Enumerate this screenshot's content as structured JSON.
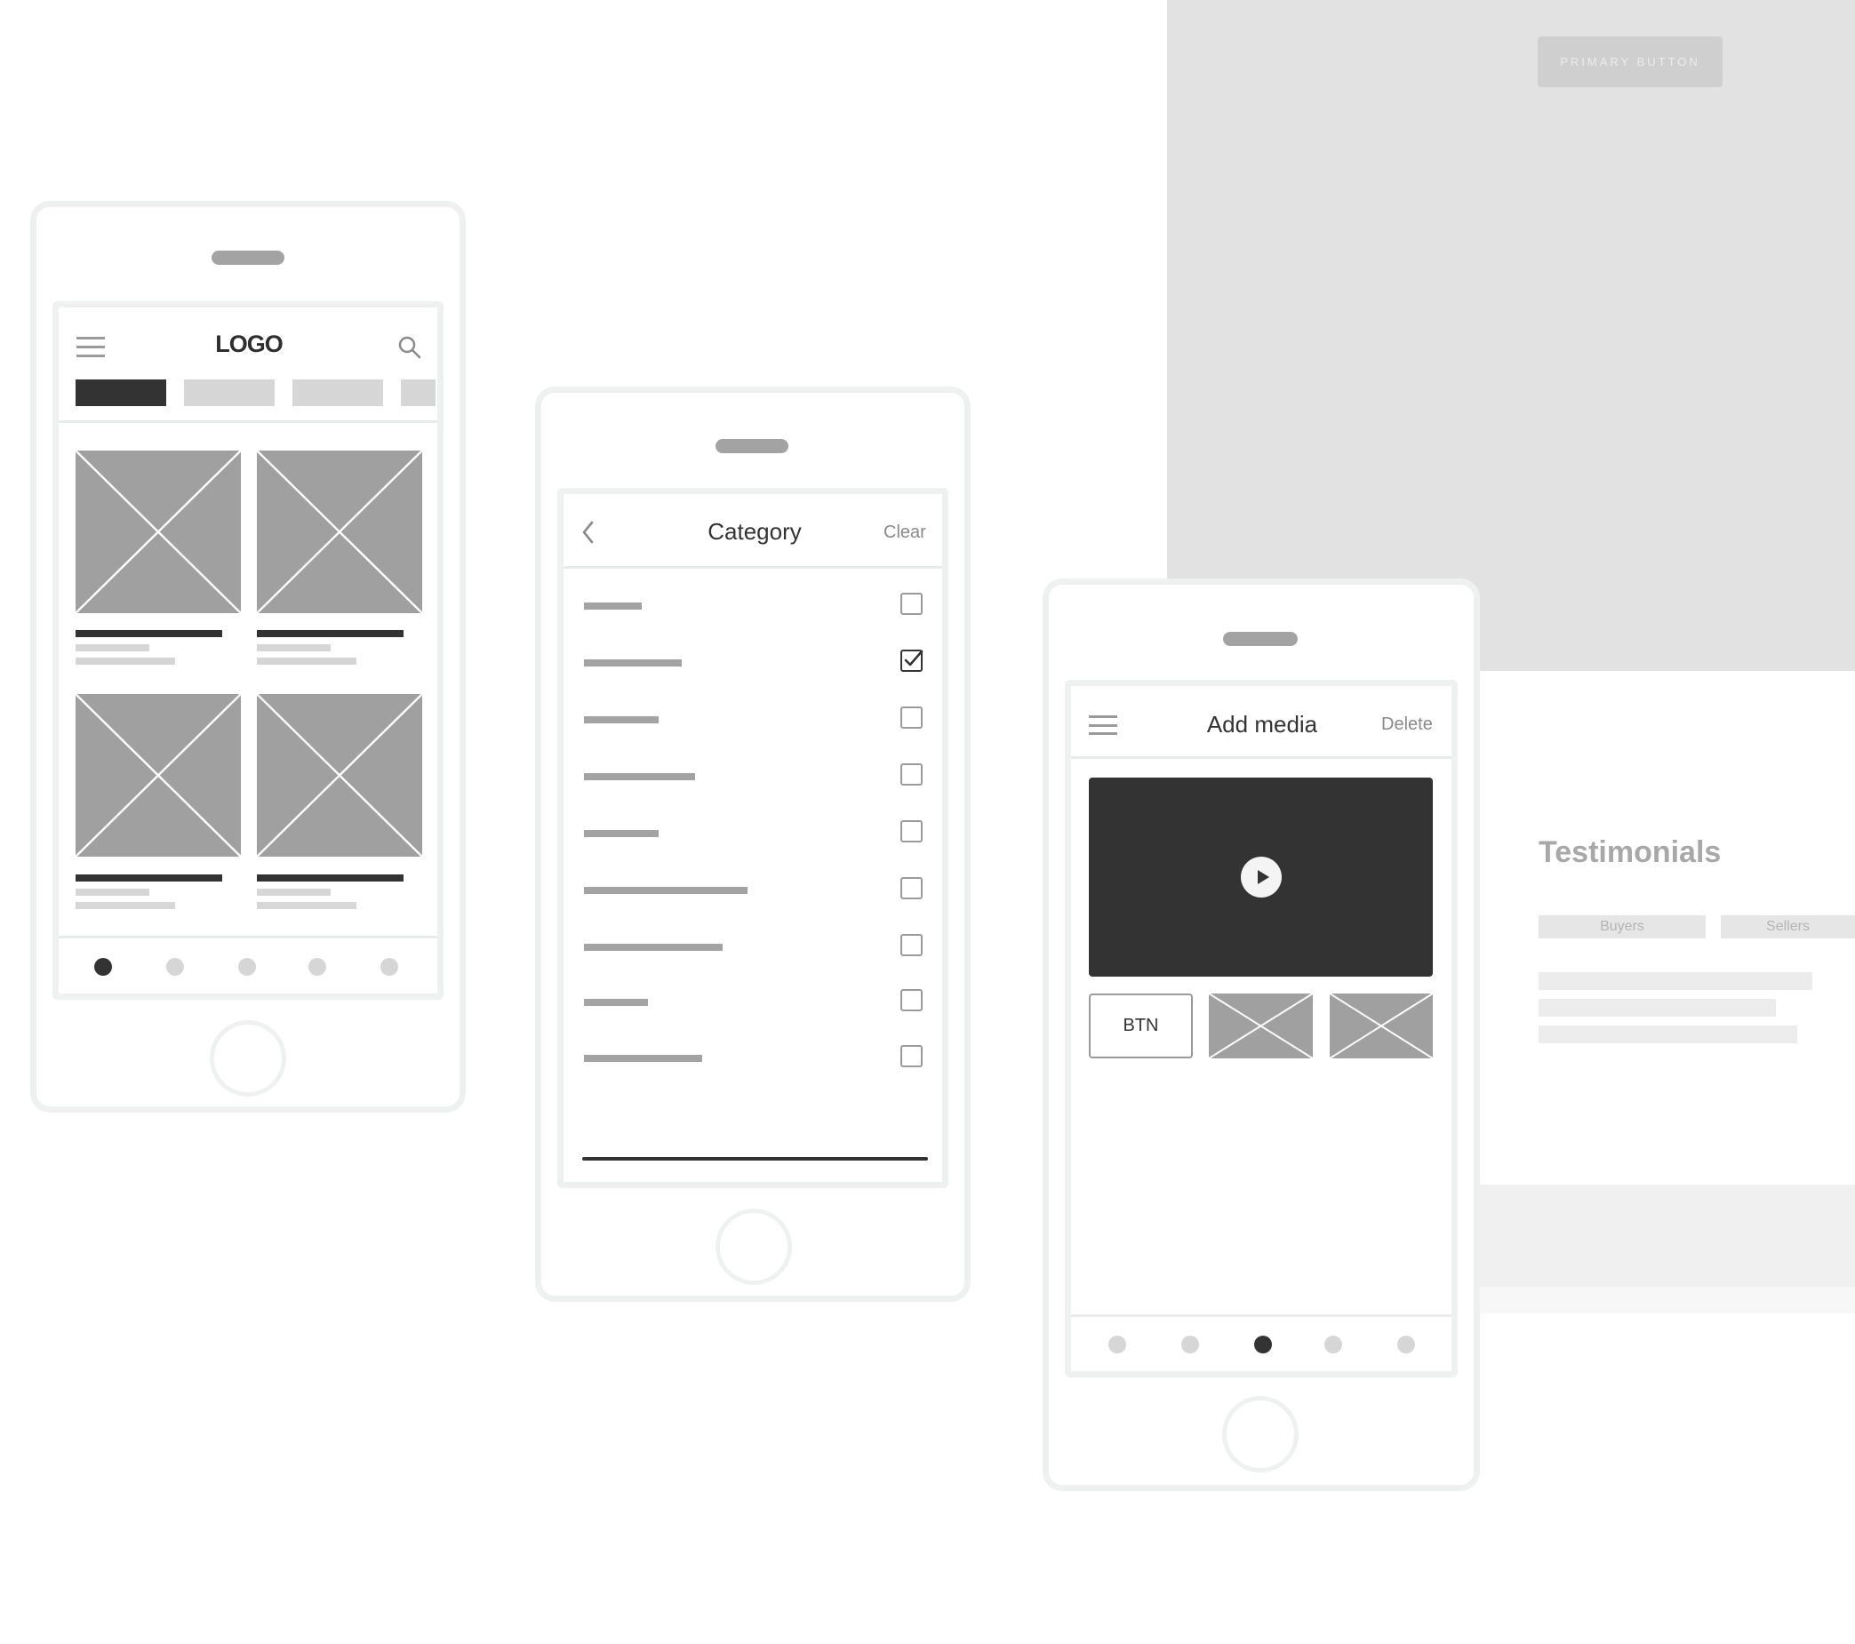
{
  "background": {
    "primary_button": "PRIMARY BUTTON",
    "testimonials_title": "Testimonials",
    "tabs": [
      "Buyers",
      "Sellers"
    ]
  },
  "phone1": {
    "logo": "LOGO",
    "icons": {
      "menu": "hamburger-icon",
      "search": "search-icon"
    },
    "filter_pills": 4,
    "active_nav_index": 0,
    "nav_dots": 5
  },
  "phone2": {
    "title": "Category",
    "clear_label": "Clear",
    "back_icon": "chevron-left-icon",
    "items": [
      {
        "checked": false
      },
      {
        "checked": true
      },
      {
        "checked": false
      },
      {
        "checked": false
      },
      {
        "checked": false
      },
      {
        "checked": false
      },
      {
        "checked": false
      },
      {
        "checked": false
      },
      {
        "checked": false
      }
    ]
  },
  "phone3": {
    "title": "Add media",
    "delete_label": "Delete",
    "button_label": "BTN",
    "icons": {
      "menu": "hamburger-icon",
      "play": "play-icon"
    },
    "active_nav_index": 2,
    "nav_dots": 5
  },
  "colors": {
    "dark": "#333333",
    "placeholder": "#a0a0a0",
    "light": "#d6d6d6",
    "frame": "#eef1f0"
  }
}
